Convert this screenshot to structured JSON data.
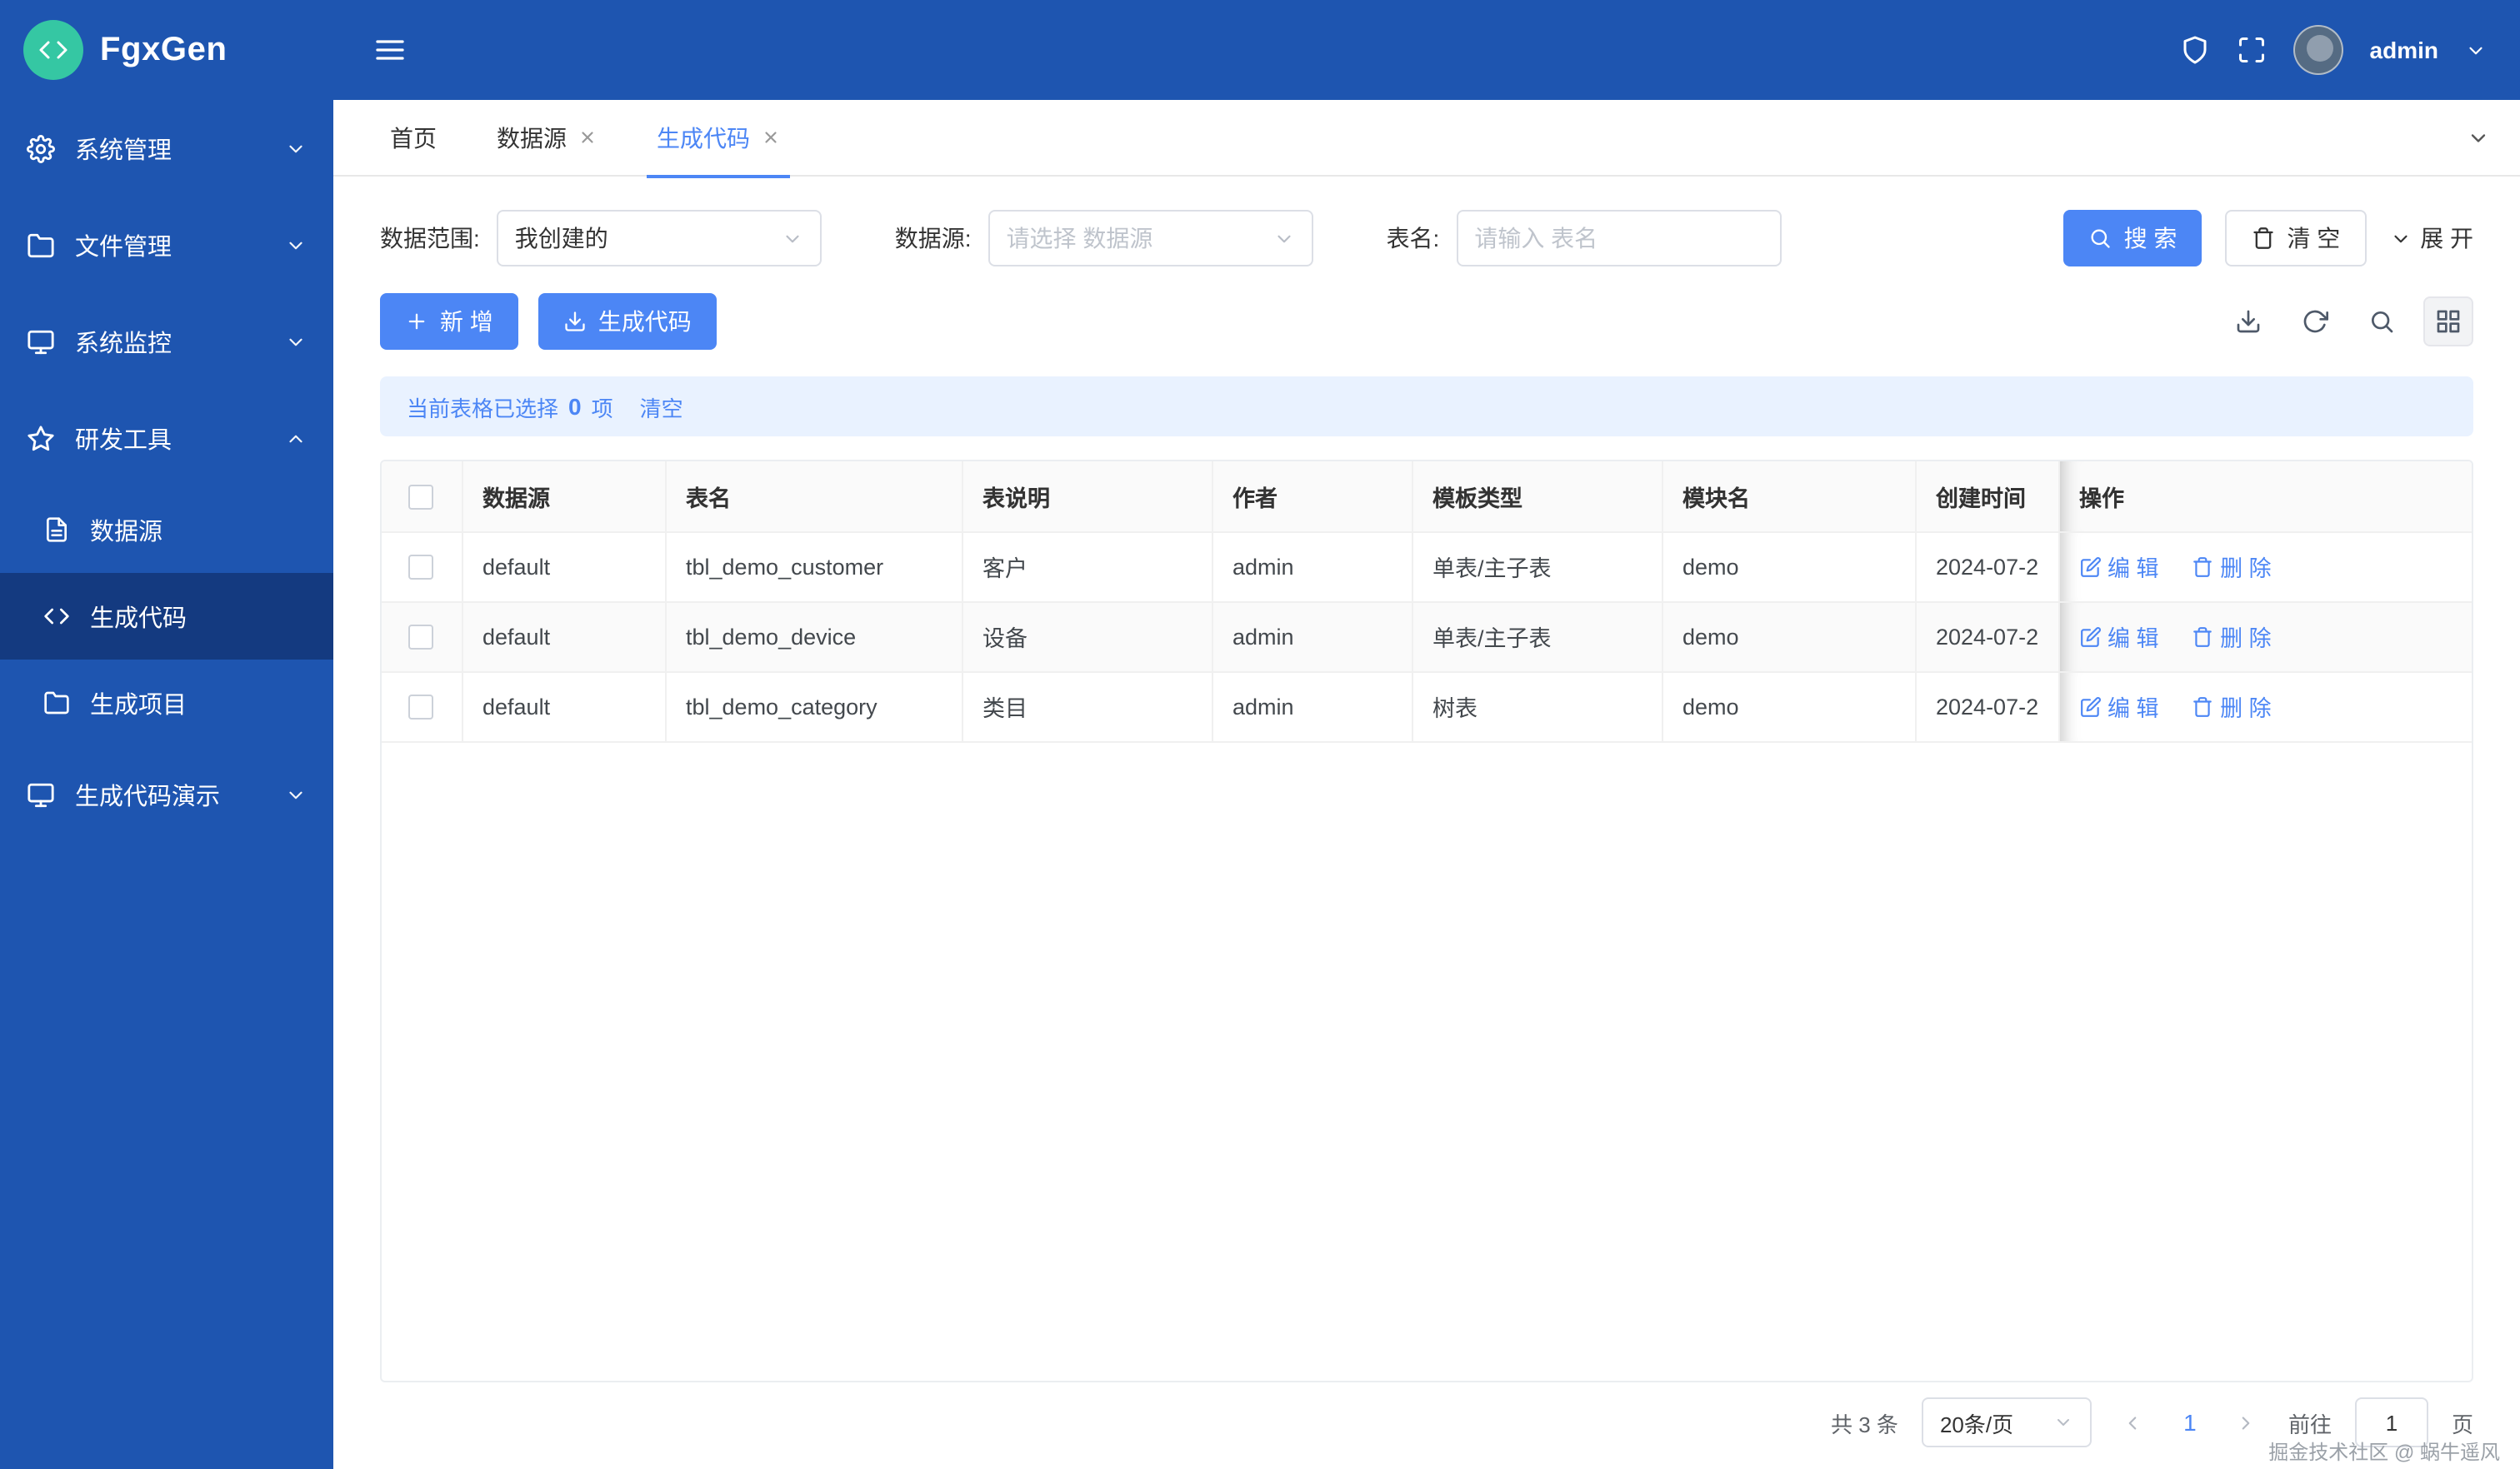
{
  "colors": {
    "primary": "#4c86f5",
    "header": "#1e55b0",
    "active": "#143a80",
    "logo": "#35c7a3"
  },
  "app": {
    "title": "FgxGen"
  },
  "header": {
    "user": "admin"
  },
  "icons": {
    "logo": "code-icon",
    "menu_toggle": "hamburger-icon",
    "header_right": [
      "shield-icon",
      "fullscreen-icon",
      "chevron-down-icon"
    ]
  },
  "sidebar": {
    "items": [
      {
        "label": "系统管理"
      },
      {
        "label": "文件管理"
      },
      {
        "label": "系统监控"
      },
      {
        "label": "研发工具"
      },
      {
        "label": "生成代码演示"
      }
    ],
    "submenu": [
      {
        "label": "数据源"
      },
      {
        "label": "生成代码"
      },
      {
        "label": "生成项目"
      }
    ]
  },
  "tabs": {
    "items": [
      {
        "label": "首页"
      },
      {
        "label": "数据源"
      },
      {
        "label": "生成代码"
      }
    ]
  },
  "filters": {
    "scope_label": "数据范围:",
    "scope_value": "我创建的",
    "datasource_label": "数据源:",
    "datasource_placeholder": "请选择 数据源",
    "table_label": "表名:",
    "table_placeholder": "请输入 表名",
    "search": "搜 索",
    "clear": "清 空",
    "expand": "展 开"
  },
  "actions": {
    "add": "新 增",
    "generate": "生成代码"
  },
  "selection": {
    "prefix": "当前表格已选择",
    "count": "0",
    "suffix": "项",
    "clear": "清空"
  },
  "table": {
    "headers": [
      "数据源",
      "表名",
      "表说明",
      "作者",
      "模板类型",
      "模块名",
      "创建时间",
      "操作"
    ],
    "edit_label": "编 辑",
    "delete_label": "删 除",
    "rows": [
      {
        "datasource": "default",
        "table": "tbl_demo_customer",
        "desc": "客户",
        "author": "admin",
        "template": "单表/主子表",
        "module": "demo",
        "created": "2024-07-2"
      },
      {
        "datasource": "default",
        "table": "tbl_demo_device",
        "desc": "设备",
        "author": "admin",
        "template": "单表/主子表",
        "module": "demo",
        "created": "2024-07-2"
      },
      {
        "datasource": "default",
        "table": "tbl_demo_category",
        "desc": "类目",
        "author": "admin",
        "template": "树表",
        "module": "demo",
        "created": "2024-07-2"
      }
    ]
  },
  "pagination": {
    "total": "共 3 条",
    "page_size": "20条/页",
    "current": "1",
    "goto_label": "前往",
    "goto_value": "1",
    "page_unit": "页"
  },
  "watermark": "掘金技术社区 @ 蜗牛遥风"
}
